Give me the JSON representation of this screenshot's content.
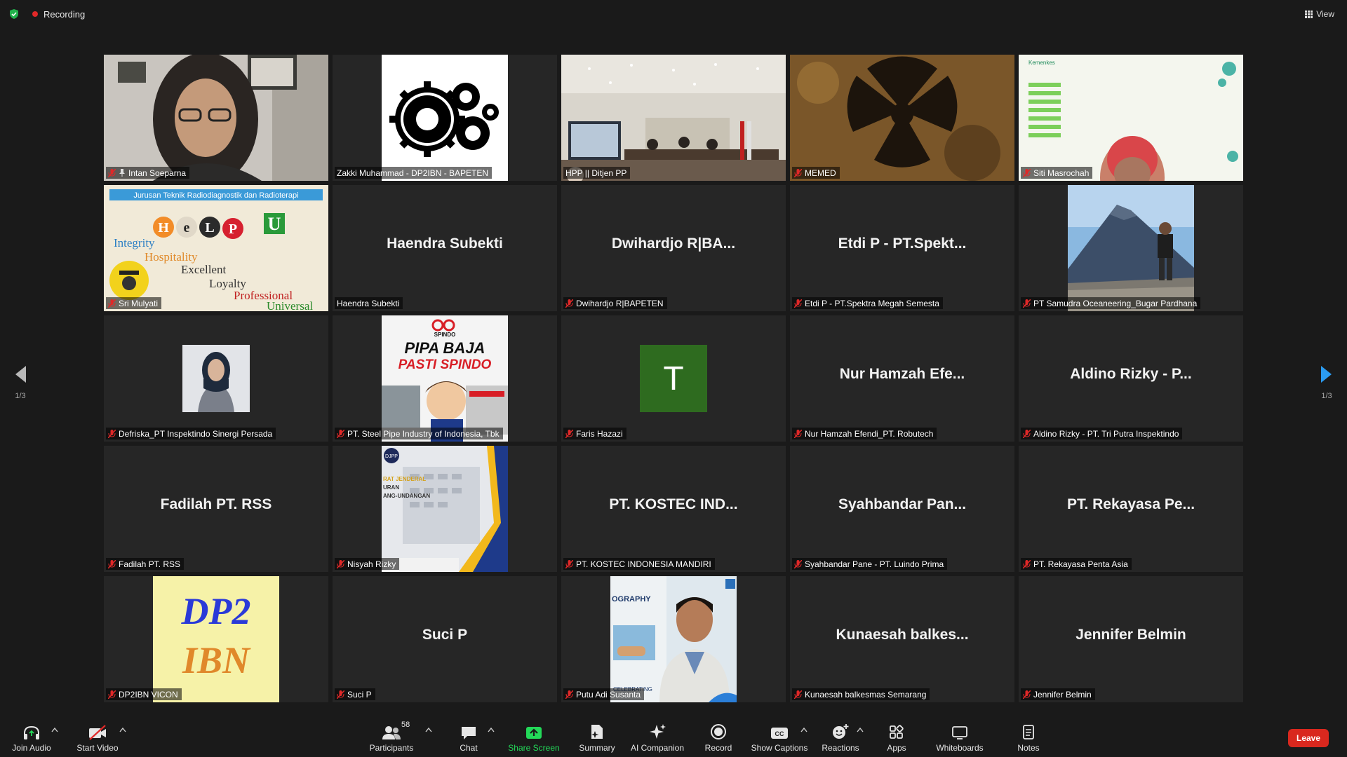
{
  "topbar": {
    "recording_label": "Recording",
    "view_label": "View"
  },
  "nav": {
    "page_indicator_left": "1/3",
    "page_indicator_right": "1/3"
  },
  "tiles": [
    {
      "name": "Intan Soeparna",
      "display": "",
      "type": "video-woman"
    },
    {
      "name": "Zakki Muhammad - DP2IBN - BAPETEN",
      "display": "",
      "type": "gears"
    },
    {
      "name": "HPP || Ditjen PP",
      "display": "",
      "type": "conference"
    },
    {
      "name": "MEMED",
      "display": "",
      "type": "radiation"
    },
    {
      "name": "Siti Masrochah",
      "display": "",
      "type": "slide-person"
    },
    {
      "name": "Sri Mulyati",
      "display": "",
      "type": "helpu"
    },
    {
      "name": "Haendra Subekti",
      "display": "Haendra Subekti",
      "type": "name"
    },
    {
      "name": "Dwihardjo R|BAPETEN",
      "display": "Dwihardjo R|BA...",
      "type": "name"
    },
    {
      "name": "Etdi P - PT.Spektra Megah Semesta",
      "display": "Etdi P - PT.Spekt...",
      "type": "name"
    },
    {
      "name": "PT Samudra Oceaneering_Bugar Pardhana",
      "display": "",
      "type": "mountain"
    },
    {
      "name": "Defriska_PT Inspektindo Sinergi Persada",
      "display": "",
      "type": "avatar-hijab"
    },
    {
      "name": "PT. Steel Pipe Industry of Indonesia, Tbk",
      "display": "",
      "type": "spindo"
    },
    {
      "name": "Faris Hazazi",
      "display": "T",
      "type": "letter"
    },
    {
      "name": "Nur Hamzah Efendi_PT. Robutech",
      "display": "Nur Hamzah Efe...",
      "type": "name"
    },
    {
      "name": "Aldino Rizky - PT. Tri Putra Inspektindo",
      "display": "Aldino Rizky - P...",
      "type": "name"
    },
    {
      "name": "Fadilah PT. RSS",
      "display": "Fadilah PT. RSS",
      "type": "name"
    },
    {
      "name": "Nisyah Rizky",
      "display": "",
      "type": "djpp"
    },
    {
      "name": "PT. KOSTEC INDONESIA MANDIRI",
      "display": "PT. KOSTEC IND...",
      "type": "name"
    },
    {
      "name": "Syahbandar Pane - PT. Luindo Prima",
      "display": "Syahbandar Pan...",
      "type": "name"
    },
    {
      "name": "PT. Rekayasa Penta Asia",
      "display": "PT. Rekayasa Pe...",
      "type": "name"
    },
    {
      "name": "DP2IBN VICON",
      "display": "",
      "type": "dp2ibn"
    },
    {
      "name": "Suci P",
      "display": "Suci P",
      "type": "name"
    },
    {
      "name": "Putu Adi Susanta",
      "display": "",
      "type": "putu"
    },
    {
      "name": "Kunaesah balkesmas Semarang",
      "display": "Kunaesah balkes...",
      "type": "name"
    },
    {
      "name": "Jennifer Belmin",
      "display": "Jennifer Belmin",
      "type": "name"
    }
  ],
  "art": {
    "helpu_heading": "Jurusan Teknik Radiodiagnostik dan Radioterapi",
    "helpu_letters": [
      "H",
      "e",
      "L",
      "P",
      "U"
    ],
    "helpu_words": [
      "Integrity",
      "Hospitality",
      "Excellent",
      "Loyalty",
      "Professional",
      "Universal"
    ],
    "spindo_brand": "SPINDO",
    "spindo_line1": "PIPA BAJA",
    "spindo_line2": "PASTI SPINDO",
    "djpp_logo": "DJPP",
    "djpp_text": [
      "RAT JENDERAL",
      "URAN",
      "ANG-UNDANGAN"
    ],
    "dp2ibn_line1": "DP2",
    "dp2ibn_line2": "IBN",
    "putu_poster_text": "OGRAPHY",
    "putu_poster_footer": "CELEBRATING",
    "siti_slide_brand": "Kemenkes"
  },
  "toolbar": {
    "join_audio": "Join Audio",
    "start_video": "Start Video",
    "participants": "Participants",
    "participants_count": "58",
    "chat": "Chat",
    "share_screen": "Share Screen",
    "summary": "Summary",
    "ai_companion": "AI Companion",
    "record": "Record",
    "show_captions": "Show Captions",
    "reactions": "Reactions",
    "apps": "Apps",
    "whiteboards": "Whiteboards",
    "notes": "Notes",
    "leave": "Leave"
  },
  "colors": {
    "active_speaker": "#c9f04a",
    "share_green": "#23d959",
    "leave_red": "#d9281e",
    "mute_red": "#e02828",
    "letter_avatar": "#2e6b1f"
  }
}
